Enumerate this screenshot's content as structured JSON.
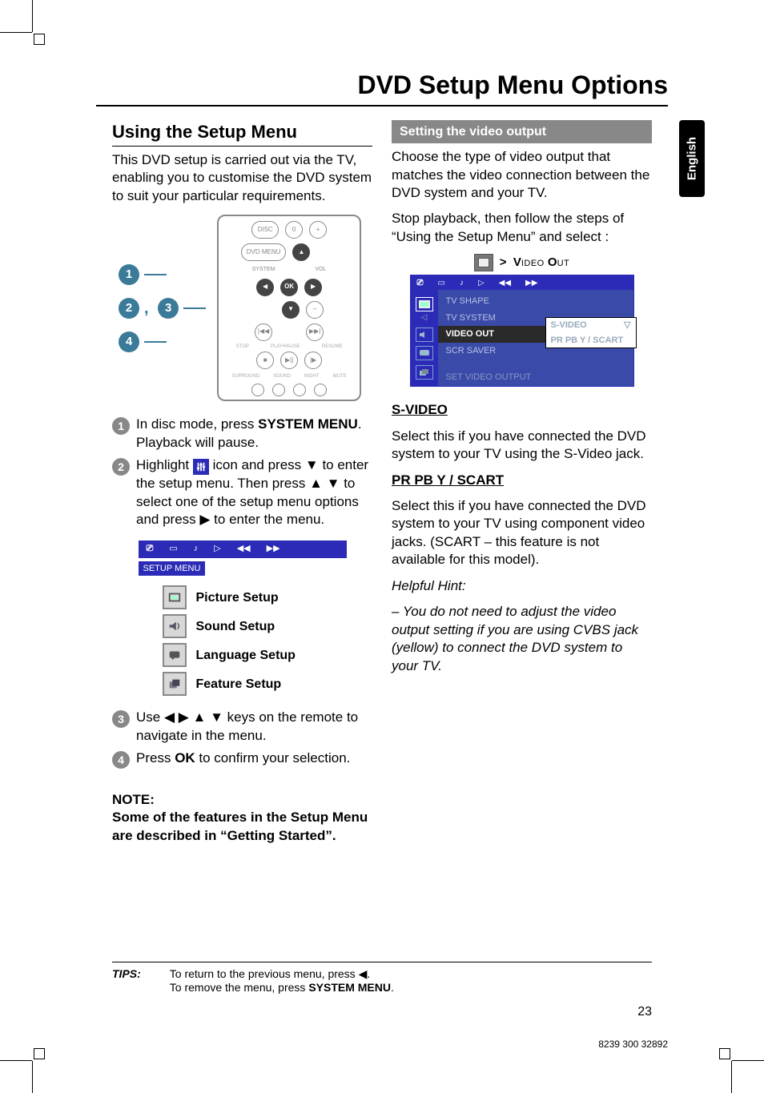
{
  "language_tab": "English",
  "page_title": "DVD Setup Menu Options",
  "page_number": "23",
  "doc_number": "8239 300 32892",
  "left": {
    "heading": "Using the Setup Menu",
    "intro": "This DVD setup is carried out via the TV, enabling you to customise the DVD system to suit your particular requirements.",
    "callout_1": "1",
    "callout_23": "2, 3",
    "callout_4": "4",
    "remote": {
      "disc": "DISC",
      "dvd_menu": "DVD MENU",
      "system": "SYSTEM",
      "zero": "0",
      "plus": "+",
      "minus": "–",
      "vol": "VOL",
      "ok": "OK",
      "stop": "STOP",
      "playpause": "PLAY•PAUSE",
      "resume": "RESUME",
      "b1": "SURROUND",
      "b2": "SOUND",
      "b3": "NIGHT",
      "b4": "MUTE"
    },
    "step1_a": "In disc mode, press ",
    "step1_bold": "SYSTEM MENU",
    "step1_b": ". Playback will pause.",
    "step2_a": "Highlight ",
    "step2_b": " icon and press ▼ to enter the setup menu.  Then press ▲ ▼ to select one of the setup menu options and press ▶ to enter the menu.",
    "setup_menu_label": "SETUP MENU",
    "topbar_icons": [
      "⎚",
      "▭",
      "🔊",
      "▷",
      "◀◀",
      "▶▶"
    ],
    "menu_items": {
      "picture": "Picture Setup",
      "sound": "Sound Setup",
      "language": "Language Setup",
      "feature": "Feature Setup"
    },
    "step3": "Use ◀ ▶ ▲ ▼ keys on the remote to navigate in the menu.",
    "step4_a": "Press ",
    "step4_bold": "OK",
    "step4_b": " to confirm your selection.",
    "note_label": "NOTE:",
    "note_body": "Some of the features in the Setup Menu are described in “Getting Started”."
  },
  "right": {
    "subheader": "Setting the video output",
    "p1": "Choose the type of video output that matches the video connection between the DVD system and your TV.",
    "p2": "Stop playback, then follow the steps of “Using the Setup Menu” and select :",
    "vo_title": ">  Video Out",
    "vo_menu": {
      "tv_shape": "TV SHAPE",
      "tv_system": "TV SYSTEM",
      "video_out": "VIDEO OUT",
      "scr_saver": "SCR SAVER",
      "footer": "SET VIDEO OUTPUT",
      "opt1": "S-VIDEO",
      "opt2": "PR PB Y / SCART"
    },
    "svideo_h": "S-VIDEO",
    "svideo_p": "Select this if you have connected the DVD system to your TV using the S-Video jack.",
    "prpb_h": "PR PB  Y / SCART",
    "prpb_p": "Select this if you have connected the DVD system to your TV using component video jacks. (SCART – this feature is not available for this model).",
    "hint_label": "Helpful Hint:",
    "hint_body": "–  You do not need to adjust the video output setting if you are using CVBS jack (yellow) to connect the DVD system to your TV."
  },
  "tips": {
    "label": "TIPS:",
    "line1_a": "To return to the previous menu, press ◀.",
    "line2_a": "To remove the menu, press ",
    "line2_bold": "SYSTEM MENU",
    "line2_b": "."
  }
}
